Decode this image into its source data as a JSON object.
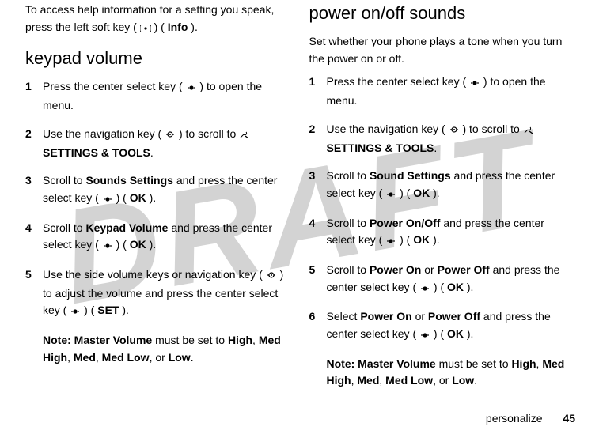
{
  "watermark": "DRAFT",
  "left": {
    "intro_a": "To access help information for a setting you speak, press the left soft key (",
    "intro_b": ") (",
    "intro_info": "Info",
    "intro_c": ").",
    "heading": "keypad volume",
    "steps": [
      {
        "n": "1",
        "pre": "Press the center select key (",
        "post": ") to open the menu."
      },
      {
        "n": "2",
        "pre": "Use the navigation key (",
        "mid": ") to scroll to ",
        "bold": "SETTINGS & TOOLS",
        "post": "."
      },
      {
        "n": "3",
        "pre": "Scroll to ",
        "bold1": "Sounds Settings",
        "mid": " and press the center select key (",
        "post_a": ") (",
        "bold2": "OK",
        "post_b": ")."
      },
      {
        "n": "4",
        "pre": "Scroll to ",
        "bold1": "Keypad Volume",
        "mid": " and press the center select key (",
        "post_a": ") (",
        "bold2": "OK",
        "post_b": ")."
      },
      {
        "n": "5",
        "pre": "Use the side volume keys or navigation key (",
        "mid": ") to adjust the volume and press the center select key (",
        "post_a": ") (",
        "bold2": "SET",
        "post_b": ")."
      }
    ],
    "note_label": "Note:",
    "note_bold1": "Master Volume",
    "note_mid": " must be set to ",
    "note_bold2": "High",
    "note_c1": ", ",
    "note_bold3": "Med High",
    "note_c2": ", ",
    "note_bold4": "Med",
    "note_c3": ", ",
    "note_bold5": "Med Low",
    "note_c4": ", or ",
    "note_bold6": "Low",
    "note_end": "."
  },
  "right": {
    "heading": "power on/off sounds",
    "intro": "Set whether your phone plays a tone when you turn the power on or off.",
    "steps": [
      {
        "n": "1",
        "pre": "Press the center select key (",
        "post": ") to open the menu."
      },
      {
        "n": "2",
        "pre": "Use the navigation key (",
        "mid": ") to scroll to ",
        "bold": "SETTINGS & TOOLS",
        "post": "."
      },
      {
        "n": "3",
        "pre": "Scroll to ",
        "bold1": "Sound Settings",
        "mid": " and press the center select key (",
        "post_a": ") (",
        "bold2": "OK",
        "post_b": ")."
      },
      {
        "n": "4",
        "pre": "Scroll to ",
        "bold1": "Power On/Off",
        "mid": " and press the center select key (",
        "post_a": ") (",
        "bold2": "OK",
        "post_b": ")."
      },
      {
        "n": "5",
        "pre": "Scroll to ",
        "bold1": "Power On",
        "mid_or": " or ",
        "bold1b": "Power Off",
        "mid": " and press the center select key (",
        "post_a": ") (",
        "bold2": "OK",
        "post_b": ")."
      },
      {
        "n": "6",
        "pre": "Select ",
        "bold1": "Power On",
        "mid_or": " or ",
        "bold1b": "Power Off",
        "mid": " and press the center select key (",
        "post_a": ") (",
        "bold2": "OK",
        "post_b": ")."
      }
    ],
    "note_label": "Note:",
    "note_bold1": "Master Volume",
    "note_mid": " must be set to ",
    "note_bold2": "High",
    "note_c1": ", ",
    "note_bold3": "Med High",
    "note_c2": ", ",
    "note_bold4": "Med",
    "note_c3": ", ",
    "note_bold5": "Med Low",
    "note_c4": ", or ",
    "note_bold6": "Low",
    "note_end": "."
  },
  "footer": {
    "section": "personalize",
    "page": "45"
  }
}
